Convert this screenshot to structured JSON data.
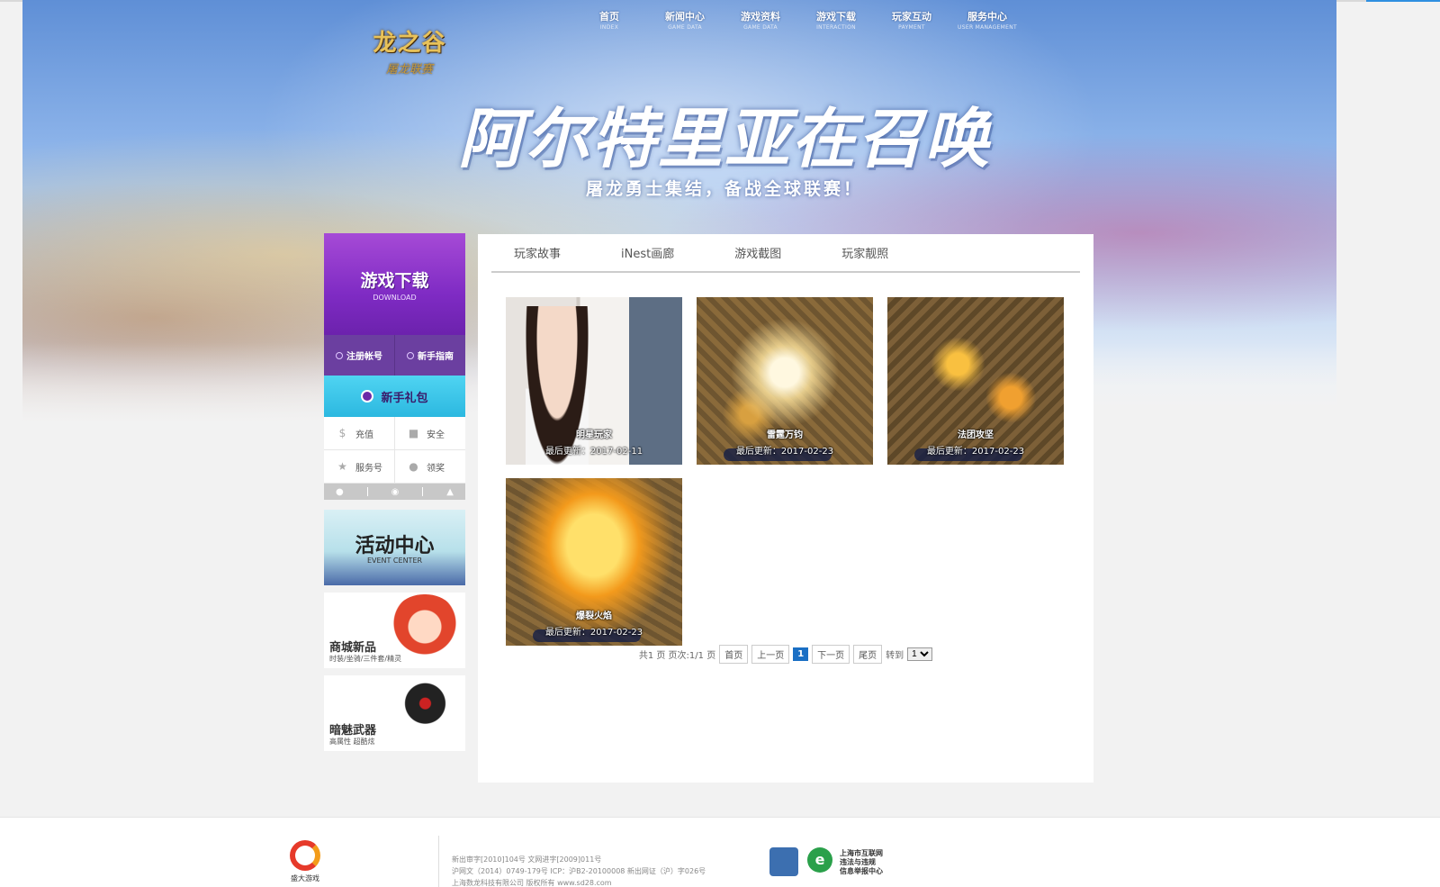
{
  "hero": {
    "logo_main": "龙之谷",
    "logo_sub": "屠龙联赛",
    "title": "阿尔特里亚在召唤",
    "subtitle": "屠龙勇士集结，备战全球联赛！"
  },
  "nav": {
    "items": [
      {
        "label": "首页",
        "en": "INDEX"
      },
      {
        "label": "新闻中心",
        "en": "GAME DATA"
      },
      {
        "label": "游戏资料",
        "en": "GAME DATA"
      },
      {
        "label": "游戏下载",
        "en": "INTERACTION"
      },
      {
        "label": "玩家互动",
        "en": "PAYMENT"
      },
      {
        "label": "服务中心",
        "en": "USER MANAGEMENT"
      }
    ]
  },
  "sidebar": {
    "download": {
      "label": "游戏下载",
      "en": "DOWNLOAD"
    },
    "register": "注册帐号",
    "guide": "新手指南",
    "gift": "新手礼包",
    "links": [
      "充值",
      "安全",
      "服务号",
      "领奖"
    ],
    "promos": {
      "event": {
        "title": "活动中心",
        "en": "EVENT CENTER"
      },
      "shop": {
        "title": "商城新品",
        "desc": "时装/坐骑/三件套/精灵"
      },
      "weapon": {
        "title": "暗魅武器",
        "desc": "高属性  超酷炫"
      }
    }
  },
  "content": {
    "tabs": [
      "玩家故事",
      "iNest画廊",
      "游戏截图",
      "玩家靓照"
    ],
    "cards": [
      {
        "title": "明星玩家",
        "date": "最后更新：2017-02-11"
      },
      {
        "title": "雷霆万钧",
        "date": "最后更新：2017-02-23"
      },
      {
        "title": "法团攻坚",
        "date": "最后更新：2017-02-23"
      },
      {
        "title": "爆裂火焰",
        "date": "最后更新：2017-02-23"
      }
    ],
    "pager": {
      "summary": "共1 页 页次:1/1 页",
      "first": "首页",
      "prev": "上一页",
      "current": "1",
      "next": "下一页",
      "last": "尾页",
      "goto": "转到",
      "select_value": "1"
    }
  },
  "footer": {
    "logo_text": "盛大游戏",
    "lines": [
      "新出审字[2010]104号  文网进字[2009]011号",
      "沪网文（2014）0749-179号  ICP：沪B2-20100008  新出网证（沪）字026号",
      "上海数龙科技有限公司  版权所有 www.sd28.com"
    ],
    "report_text": [
      "上海市互联网",
      "违法与违规",
      "信息举报中心"
    ]
  }
}
